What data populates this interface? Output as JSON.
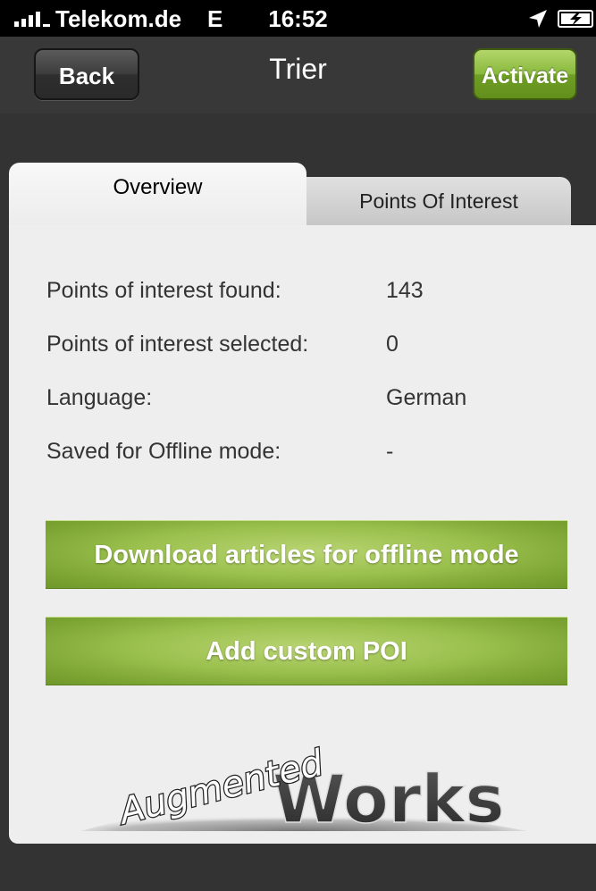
{
  "status_bar": {
    "carrier": "Telekom.de",
    "network": "E",
    "time": "16:52"
  },
  "navbar": {
    "back_label": "Back",
    "title": "Trier",
    "activate_label": "Activate"
  },
  "tabs": [
    {
      "label": "Overview",
      "selected": true
    },
    {
      "label": "Points Of Interest",
      "selected": false
    }
  ],
  "overview": {
    "rows": [
      {
        "label": "Points of interest found:",
        "value": "143"
      },
      {
        "label": "Points of interest selected:",
        "value": "0"
      },
      {
        "label": "Language:",
        "value": "German"
      },
      {
        "label": "Saved for Offline mode:",
        "value": "-"
      }
    ],
    "download_button": "Download articles for offline mode",
    "add_poi_button": "Add custom POI"
  },
  "logo": {
    "word1": "Augmented",
    "word2": "Works"
  },
  "colors": {
    "accent_green": "#8dbb40",
    "nav_background": "#383838",
    "panel_background": "#eeeeee"
  }
}
